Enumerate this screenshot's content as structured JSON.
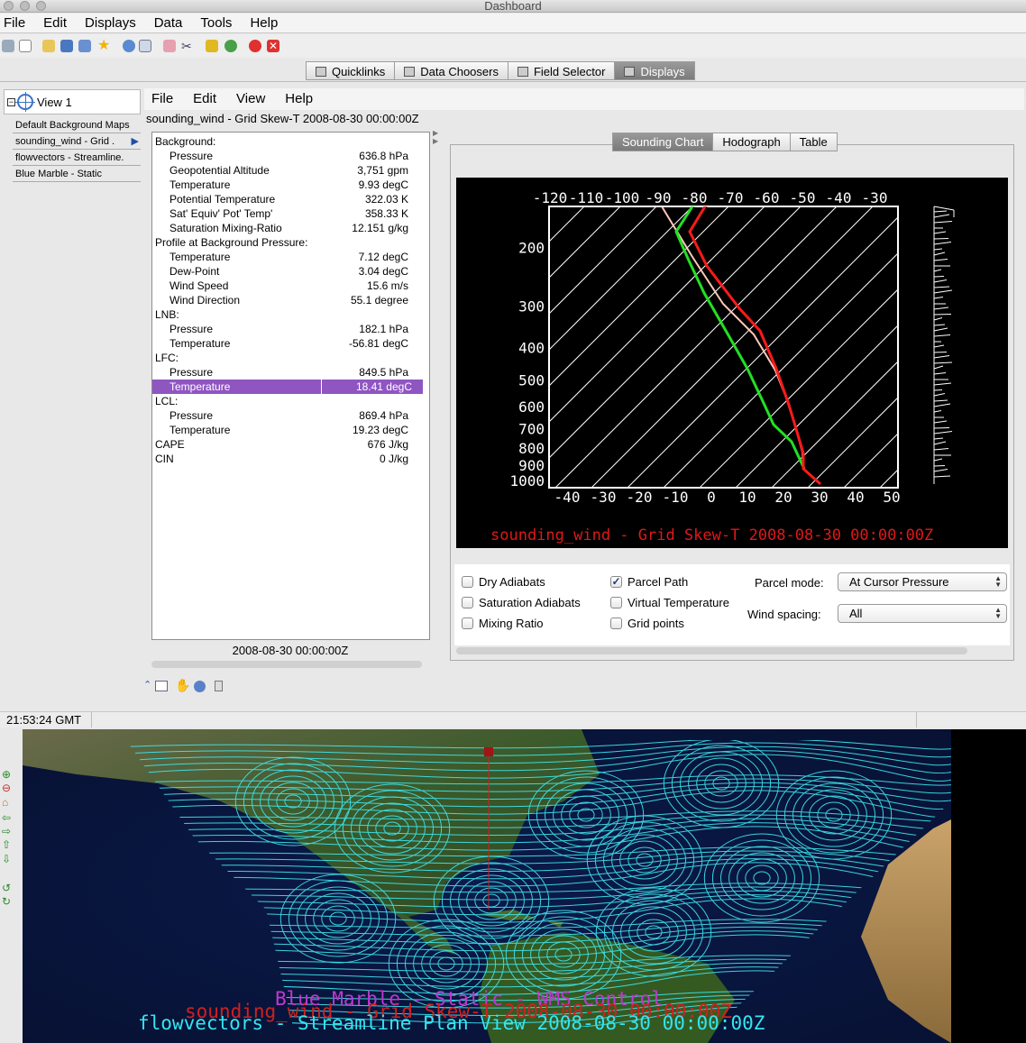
{
  "window": {
    "title": "Dashboard"
  },
  "menubar": [
    "File",
    "Edit",
    "Displays",
    "Data",
    "Tools",
    "Help"
  ],
  "toolbar_icons": [
    "exit-icon",
    "new-window-icon",
    "open-folder-icon",
    "save-icon",
    "save-all-icon",
    "favorite-star-icon",
    "help-icon",
    "mail-icon",
    "eraser-icon",
    "scissors-icon",
    "pencil-icon",
    "globe-icon",
    "stop-red-icon",
    "close-red-icon"
  ],
  "tabs": [
    {
      "label": "Quicklinks",
      "icon": "quicklinks-icon"
    },
    {
      "label": "Data Choosers",
      "icon": "data-choosers-icon"
    },
    {
      "label": "Field Selector",
      "icon": "field-selector-icon"
    },
    {
      "label": "Displays",
      "icon": "displays-icon",
      "active": true
    }
  ],
  "view": {
    "label": "View 1",
    "layers": [
      "Default Background Maps",
      "sounding_wind - Grid .",
      "flowvectors - Streamline.",
      "Blue Marble - Static"
    ]
  },
  "display_menu": [
    "File",
    "Edit",
    "View",
    "Help"
  ],
  "display_title": "sounding_wind - Grid Skew-T 2008-08-30 00:00:00Z",
  "info_rows": [
    {
      "key": "Background:",
      "value": "",
      "indent": false
    },
    {
      "key": "Pressure",
      "value": "636.8 hPa",
      "indent": true
    },
    {
      "key": "Geopotential Altitude",
      "value": "3,751 gpm",
      "indent": true
    },
    {
      "key": "Temperature",
      "value": "9.93 degC",
      "indent": true
    },
    {
      "key": "Potential Temperature",
      "value": "322.03 K",
      "indent": true
    },
    {
      "key": "Sat' Equiv' Pot' Temp'",
      "value": "358.33 K",
      "indent": true
    },
    {
      "key": "Saturation Mixing-Ratio",
      "value": "12.151 g/kg",
      "indent": true
    },
    {
      "key": "Profile at Background Pressure:",
      "value": "",
      "indent": false
    },
    {
      "key": "Temperature",
      "value": "7.12 degC",
      "indent": true
    },
    {
      "key": "Dew-Point",
      "value": "3.04 degC",
      "indent": true
    },
    {
      "key": "Wind Speed",
      "value": "15.6 m/s",
      "indent": true
    },
    {
      "key": "Wind Direction",
      "value": "55.1 degree",
      "indent": true
    },
    {
      "key": "LNB:",
      "value": "",
      "indent": false
    },
    {
      "key": "Pressure",
      "value": "182.1 hPa",
      "indent": true
    },
    {
      "key": "Temperature",
      "value": "-56.81 degC",
      "indent": true
    },
    {
      "key": "LFC:",
      "value": "",
      "indent": false
    },
    {
      "key": "Pressure",
      "value": "849.5 hPa",
      "indent": true
    },
    {
      "key": "Temperature",
      "value": "18.41 degC",
      "indent": true,
      "selected": true
    },
    {
      "key": "LCL:",
      "value": "",
      "indent": false
    },
    {
      "key": "Pressure",
      "value": "869.4 hPa",
      "indent": true
    },
    {
      "key": "Temperature",
      "value": "19.23 degC",
      "indent": true
    },
    {
      "key": "CAPE",
      "value": "676 J/kg",
      "indent": false
    },
    {
      "key": "CIN",
      "value": "0 J/kg",
      "indent": false
    }
  ],
  "info_date": "2008-08-30 00:00:00Z",
  "chart_tabs": [
    {
      "label": "Sounding Chart",
      "active": true
    },
    {
      "label": "Hodograph",
      "active": false
    },
    {
      "label": "Table",
      "active": false
    }
  ],
  "skewt": {
    "top_ticks": [
      "-120",
      "-110",
      "-100",
      "-90",
      "-80",
      "-70",
      "-60",
      "-50",
      "-40",
      "-30"
    ],
    "bottom_ticks": [
      "-40",
      "-30",
      "-20",
      "-10",
      "0",
      "10",
      "20",
      "30",
      "40",
      "50"
    ],
    "pressure_ticks": [
      "200",
      "300",
      "400",
      "500",
      "600",
      "700",
      "800",
      "900",
      "1000"
    ],
    "caption": "sounding_wind - Grid Skew-T 2008-08-30 00:00:00Z",
    "colors": {
      "temperature": "#ff1a1a",
      "dewpoint": "#22e022",
      "parcel": "#ffc8b8",
      "caption": "#e01818",
      "axis": "#ffffff"
    }
  },
  "controls": {
    "checkboxes": [
      {
        "label": "Dry Adiabats",
        "checked": false
      },
      {
        "label": "Saturation Adiabats",
        "checked": false
      },
      {
        "label": "Mixing Ratio",
        "checked": false
      },
      {
        "label": "Parcel Path",
        "checked": true
      },
      {
        "label": "Virtual Temperature",
        "checked": false
      },
      {
        "label": "Grid points",
        "checked": false
      }
    ],
    "parcel_mode_label": "Parcel mode:",
    "parcel_mode_value": "At Cursor Pressure",
    "wind_spacing_label": "Wind spacing:",
    "wind_spacing_value": "All"
  },
  "status": {
    "time": "21:53:24 GMT"
  },
  "map": {
    "labels": [
      {
        "text": "Blue Marble - Static - WMS Control",
        "color": "#c038d0"
      },
      {
        "text": "sounding_wind - Grid Skew-T 2008-08-30 00:00:00Z",
        "color": "#d02020"
      },
      {
        "text": "flowvectors - Streamline Plan View 2008-08-30 00:00:00Z",
        "color": "#33e6f0"
      }
    ],
    "side_icons": [
      "zoom-in-icon",
      "zoom-out-icon",
      "home-icon",
      "pan-left-icon",
      "pan-right-icon",
      "pan-up-icon",
      "pan-down-icon",
      "rotate-left-icon",
      "rotate-right-icon"
    ]
  }
}
